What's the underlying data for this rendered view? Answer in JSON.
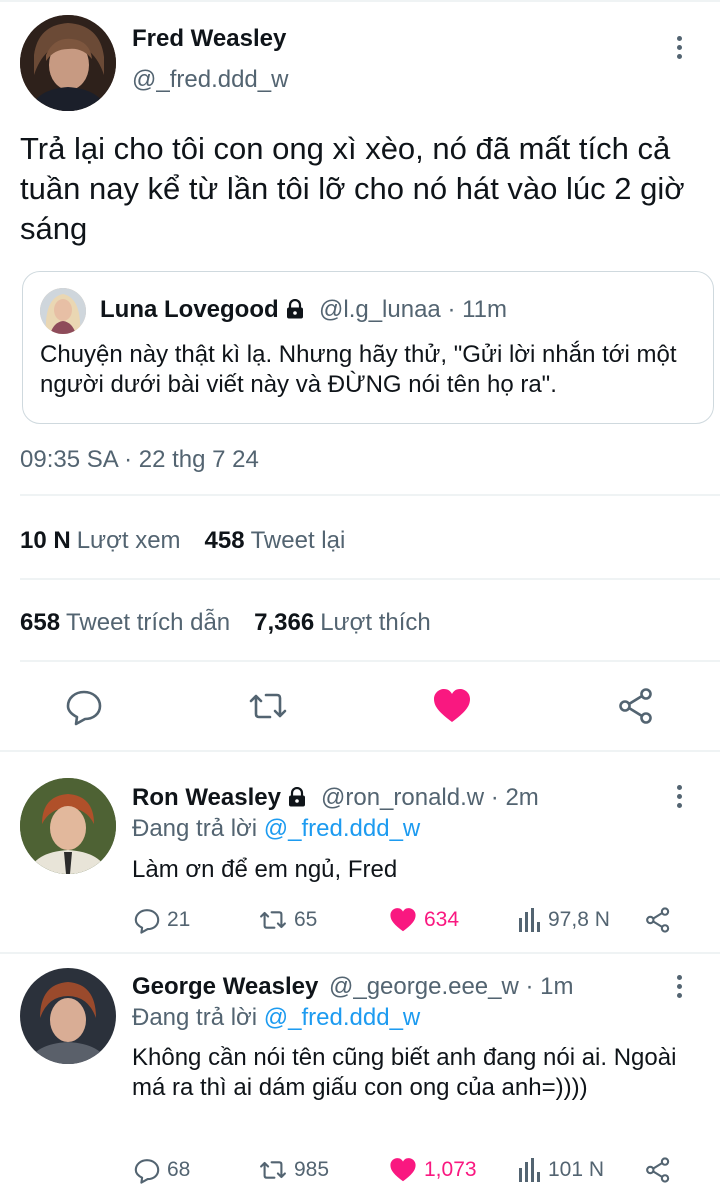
{
  "main_tweet": {
    "author_name": "Fred Weasley",
    "author_handle": "@_fred.ddd_w",
    "text": "Trả lại cho tôi con ong xì xèo, nó đã mất tích cả tuần nay kể từ lần tôi lỡ cho nó hát vào lúc 2 giờ sáng",
    "quote": {
      "author_name": "Luna Lovegood",
      "meta": "@l.g_lunaa · 11m",
      "text": "Chuyện này thật kì lạ. Nhưng hãy thử, \"Gửi lời nhắn tới một người dưới bài viết này và ĐỪNG nói tên họ ra\"."
    },
    "timestamp": "09:35 SA · 22 thg 7 24",
    "stats": {
      "views_count": "10 N",
      "views_label": "Lượt xem",
      "retweets_count": "458",
      "retweets_label": "Tweet lại",
      "quotes_count": "658",
      "quotes_label": "Tweet trích dẫn",
      "likes_count": "7,366",
      "likes_label": "Lượt thích"
    },
    "actions": [
      "reply-icon",
      "retweet-icon",
      "heart-icon",
      "share-icon"
    ]
  },
  "replies": [
    {
      "author_name": "Ron Weasley",
      "meta": "@ron_ronald.w · 2m",
      "replying_prefix": "Đang trả lời",
      "replying_to": "@_fred.ddd_w",
      "text": "Làm ơn để em ngủ, Fred",
      "reply_count": "21",
      "retweet_count": "65",
      "like_count": "634",
      "view_count": "97,8 N"
    },
    {
      "author_name": "George Weasley",
      "meta": "@_george.eee_w · 1m",
      "replying_prefix": "Đang trả lời",
      "replying_to": "@_fred.ddd_w",
      "text": "Không cần nói tên cũng biết anh đang nói ai. Ngoài má ra thì ai dám giấu con ong của anh=))))",
      "reply_count": "68",
      "retweet_count": "985",
      "like_count": "1,073",
      "view_count": "101 N"
    }
  ],
  "colors": {
    "like": "#f91880",
    "link": "#1d9bf0",
    "secondary_text": "#536471",
    "border": "#cfd9de"
  }
}
